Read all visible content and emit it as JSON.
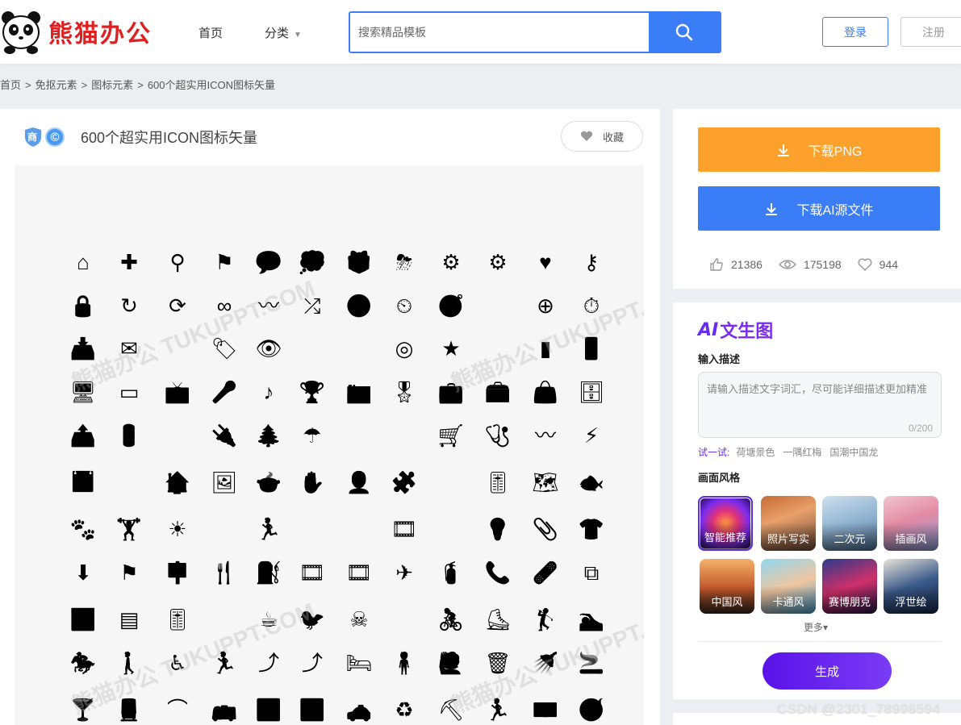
{
  "header": {
    "brand": "熊猫办公",
    "nav": {
      "home": "首页",
      "category": "分类"
    },
    "search": {
      "placeholder": "搜索精品模板"
    },
    "login": "登录",
    "register": "注册"
  },
  "breadcrumb": [
    "首页",
    "免抠元素",
    "图标元素",
    "600个超实用ICON图标矢量"
  ],
  "breadcrumb_sep": ">",
  "main": {
    "badge_shang": "商",
    "badge_c": "©",
    "title": "600个超实用ICON图标矢量",
    "favorite": "收藏",
    "watermark": "熊猫办公 TUKUPPT.COM"
  },
  "icons": [
    [
      "⌂",
      "✚",
      "⚲",
      "⚑",
      "💬",
      "💭",
      "🎁",
      "⛈",
      "⚙",
      "⚙",
      "♥",
      "⚷"
    ],
    [
      "🔒",
      "↻",
      "⟳",
      "∞",
      "〰",
      "⤮",
      "🕒",
      "⏲",
      "🧭",
      "",
      "⊕",
      "⏱"
    ],
    [
      "📥",
      "✉",
      "",
      "🏷",
      "👁",
      "",
      "",
      "◎",
      "★",
      "",
      "▮",
      "📱"
    ],
    [
      "🖥",
      "▭",
      "📺",
      "🎤",
      "♪",
      "🏆",
      "📷",
      "🎖",
      "💼",
      "🧰",
      "👜",
      "🗄"
    ],
    [
      "📤",
      "🔋",
      "",
      "🔌",
      "🌲",
      "☂",
      "",
      "",
      "🛒",
      "🩺",
      "〰",
      "⚡"
    ],
    [
      "📅",
      "",
      "🏠",
      "🖼",
      "🍲",
      "✋",
      "👤",
      "🧩",
      "",
      "🎚",
      "🗺",
      "🐟"
    ],
    [
      "🐾",
      "🏋",
      "☀",
      "",
      "🏃",
      "",
      "",
      "🎞",
      "",
      "💡",
      "📎",
      "👕"
    ],
    [
      "⬇",
      "⚑",
      "🪧",
      "🍴",
      "⛽",
      "🎞",
      "🎞",
      "✈",
      "🧯",
      "📞",
      "🩹",
      "⧉"
    ],
    [
      "🎹",
      "▤",
      "🎚",
      "",
      "☕",
      "🐦",
      "☠",
      "",
      "🚴",
      "⛸",
      "🏌",
      "🏊"
    ],
    [
      "🏇",
      "🚶",
      "♿",
      "🏃",
      "⤴",
      "⤴",
      "🛏",
      "🧍",
      "🙋",
      "🗑",
      "🚿",
      "🚬"
    ],
    [
      "🍸",
      "🚆",
      "⌒",
      "🚌",
      "🚹",
      "🚺",
      "🚕",
      "♻",
      "⛏",
      "🏃",
      "💵",
      "🚭"
    ]
  ],
  "side": {
    "download_png": "下载PNG",
    "download_ai": "下载AI源文件",
    "stats": {
      "likes": "21386",
      "views": "175198",
      "favorites": "944"
    }
  },
  "ai_panel": {
    "logo_ai": "AI",
    "logo_text": "文生图",
    "input_label": "输入描述",
    "input_placeholder": "请输入描述文字词汇，尽可能详细描述更加精准",
    "char_count": "0/200",
    "try_label": "试一试:",
    "try_tags": [
      "荷塘景色",
      "一隅红梅",
      "国潮中国龙"
    ],
    "style_label": "画面风格",
    "styles": [
      {
        "label": "智能推荐",
        "selected": true
      },
      {
        "label": "照片写实",
        "selected": false
      },
      {
        "label": "二次元",
        "selected": false
      },
      {
        "label": "插画风",
        "selected": false
      },
      {
        "label": "中国风",
        "selected": false
      },
      {
        "label": "卡通风",
        "selected": false
      },
      {
        "label": "赛博朋克",
        "selected": false
      },
      {
        "label": "浮世绘",
        "selected": false
      }
    ],
    "more": "更多▾",
    "generate": "生成"
  },
  "footer_watermark": "CSDN @2301_78998594",
  "colors": {
    "primary": "#3b7cf7",
    "orange": "#fca22c",
    "purple": "#5a12e8",
    "brand_red": "#e02020"
  }
}
